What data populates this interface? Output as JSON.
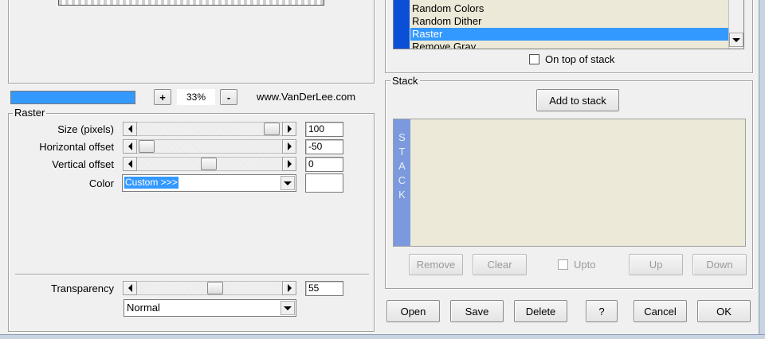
{
  "colors": {
    "accent": "#3399ff",
    "stack_blue": "#0b4fd6",
    "stack_bar": "#7b99dc",
    "list_bg": "#ece9d8"
  },
  "preview": {
    "zoom_in_label": "+",
    "zoom_value": "33%",
    "zoom_out_label": "-",
    "website": "www.VanDerLee.com"
  },
  "filter_list": {
    "items": [
      "Random Colors",
      "Random Dither",
      "Raster",
      "Remove Gray"
    ],
    "selected_index": 2
  },
  "on_top_of_stack": {
    "label": "On top of stack",
    "checked": false
  },
  "raster": {
    "title": "Raster",
    "controls": [
      {
        "label": "Size (pixels)",
        "value": "100"
      },
      {
        "label": "Horizontal offset",
        "value": "-50"
      },
      {
        "label": "Vertical offset",
        "value": "0"
      }
    ],
    "color_label": "Color",
    "color_value": "Custom >>>",
    "transparency_label": "Transparency",
    "transparency_value": "55",
    "blend_mode": "Normal"
  },
  "stack": {
    "title": "Stack",
    "add_label": "Add to stack",
    "side_letters": [
      "S",
      "T",
      "A",
      "C",
      "K"
    ],
    "remove_label": "Remove",
    "clear_label": "Clear",
    "upto_label": "Upto",
    "up_label": "Up",
    "down_label": "Down"
  },
  "footer": {
    "open_label": "Open",
    "save_label": "Save",
    "delete_label": "Delete",
    "help_label": "?",
    "cancel_label": "Cancel",
    "ok_label": "OK"
  }
}
